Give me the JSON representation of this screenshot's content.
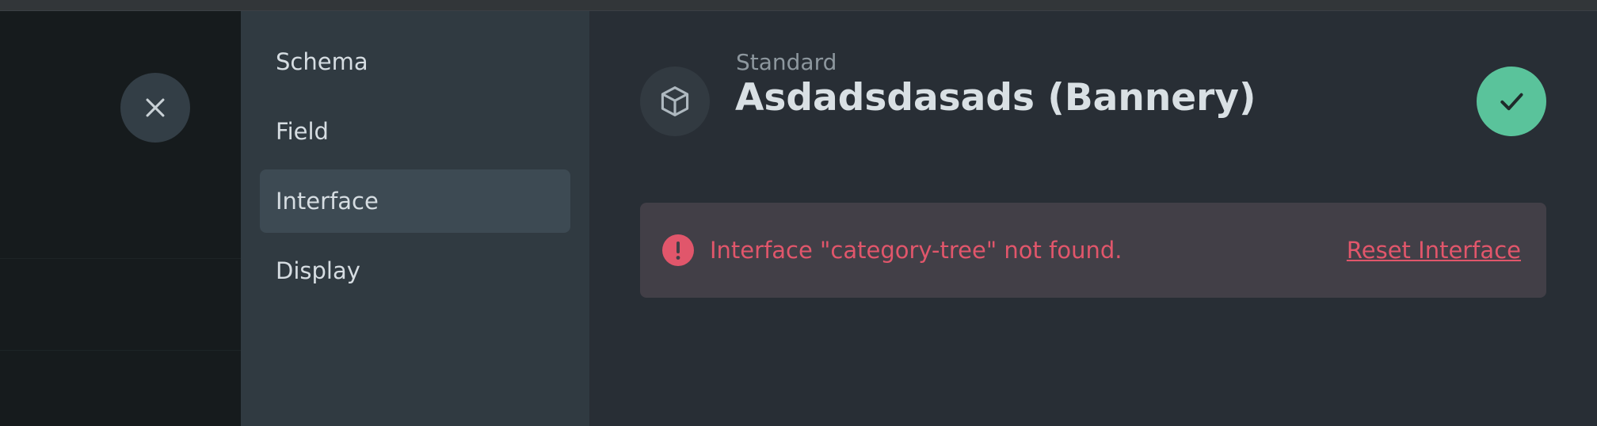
{
  "overlay": {
    "close_icon": "close-icon"
  },
  "nav": {
    "items": [
      {
        "label": "Schema",
        "active": false
      },
      {
        "label": "Field",
        "active": false
      },
      {
        "label": "Interface",
        "active": true
      },
      {
        "label": "Display",
        "active": false
      }
    ]
  },
  "header": {
    "eyebrow": "Standard",
    "title": "Asdadsdasads (Bannery)",
    "icon": "box-icon",
    "save_icon": "check-icon"
  },
  "notice": {
    "icon": "alert-icon",
    "message": "Interface \"category-tree\" not found.",
    "action_label": "Reset Interface"
  },
  "colors": {
    "accent_success": "#5ac39b",
    "danger": "#e1566b",
    "nav_active": "#3d4a53"
  }
}
